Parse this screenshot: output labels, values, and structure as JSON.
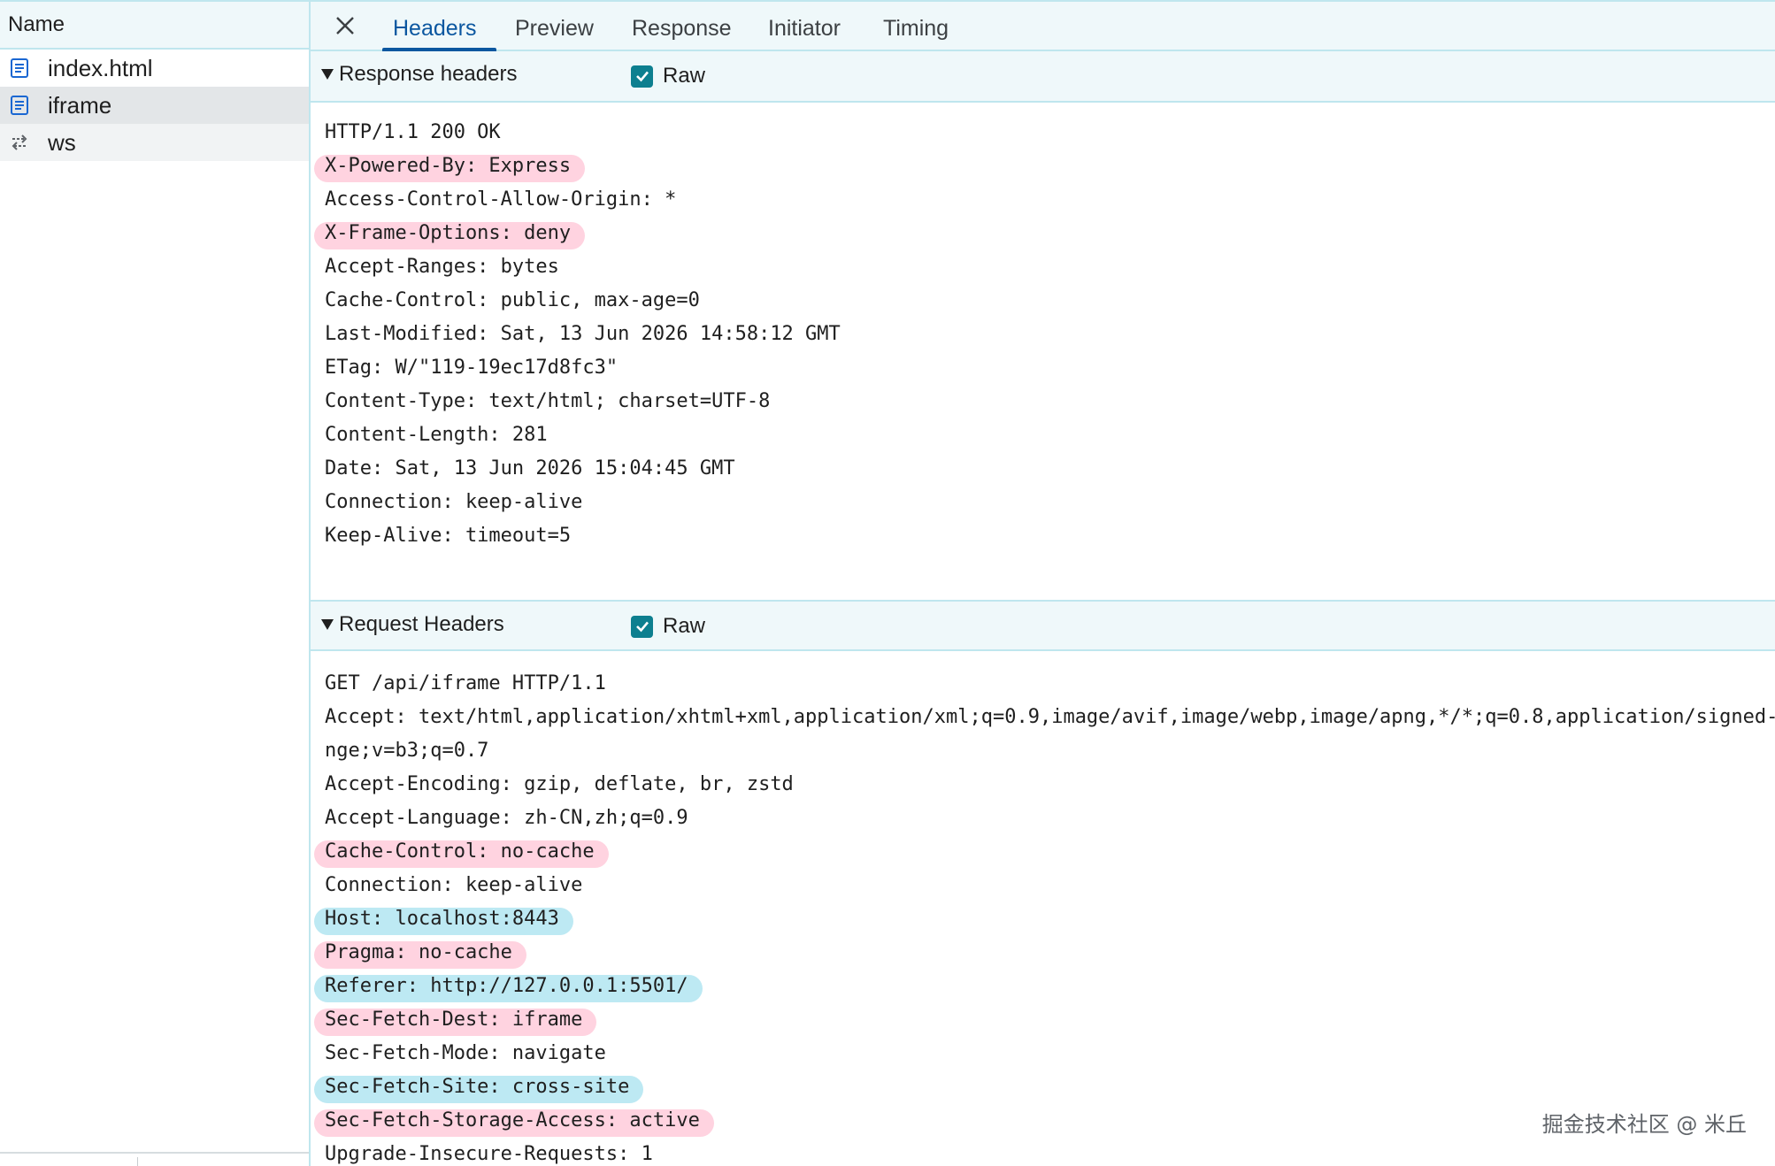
{
  "sidebar": {
    "header": "Name",
    "items": [
      {
        "label": "index.html",
        "icon": "document-icon"
      },
      {
        "label": "iframe",
        "icon": "document-icon"
      },
      {
        "label": "ws",
        "icon": "websocket-icon"
      }
    ]
  },
  "tabs": [
    "Headers",
    "Preview",
    "Response",
    "Initiator",
    "Timing"
  ],
  "active_tab": "Headers",
  "response_section": {
    "title": "Response headers",
    "raw_label": "Raw",
    "raw_checked": true,
    "lines": [
      {
        "text": "HTTP/1.1 200 OK",
        "highlight": ""
      },
      {
        "text": "X-Powered-By: Express",
        "highlight": "pink"
      },
      {
        "text": "Access-Control-Allow-Origin: *",
        "highlight": ""
      },
      {
        "text": "X-Frame-Options: deny",
        "highlight": "pink"
      },
      {
        "text": "Accept-Ranges: bytes",
        "highlight": ""
      },
      {
        "text": "Cache-Control: public, max-age=0",
        "highlight": ""
      },
      {
        "text": "Last-Modified: Sat, 13 Jun 2026 14:58:12 GMT",
        "highlight": ""
      },
      {
        "text": "ETag: W/\"119-19ec17d8fc3\"",
        "highlight": ""
      },
      {
        "text": "Content-Type: text/html; charset=UTF-8",
        "highlight": ""
      },
      {
        "text": "Content-Length: 281",
        "highlight": ""
      },
      {
        "text": "Date: Sat, 13 Jun 2026 15:04:45 GMT",
        "highlight": ""
      },
      {
        "text": "Connection: keep-alive",
        "highlight": ""
      },
      {
        "text": "Keep-Alive: timeout=5",
        "highlight": ""
      }
    ]
  },
  "request_section": {
    "title": "Request Headers",
    "raw_label": "Raw",
    "raw_checked": true,
    "lines": [
      {
        "text": "GET /api/iframe HTTP/1.1",
        "highlight": ""
      },
      {
        "text": "Accept: text/html,application/xhtml+xml,application/xml;q=0.9,image/avif,image/webp,image/apng,*/*;q=0.8,application/signed-",
        "highlight": ""
      },
      {
        "text": "nge;v=b3;q=0.7",
        "highlight": ""
      },
      {
        "text": "Accept-Encoding: gzip, deflate, br, zstd",
        "highlight": ""
      },
      {
        "text": "Accept-Language: zh-CN,zh;q=0.9",
        "highlight": ""
      },
      {
        "text": "Cache-Control: no-cache",
        "highlight": "pink"
      },
      {
        "text": "Connection: keep-alive",
        "highlight": ""
      },
      {
        "text": "Host: localhost:8443",
        "highlight": "blue"
      },
      {
        "text": "Pragma: no-cache",
        "highlight": "pink"
      },
      {
        "text": "Referer: http://127.0.0.1:5501/",
        "highlight": "blue"
      },
      {
        "text": "Sec-Fetch-Dest: iframe",
        "highlight": "pink"
      },
      {
        "text": "Sec-Fetch-Mode: navigate",
        "highlight": ""
      },
      {
        "text": "Sec-Fetch-Site: cross-site",
        "highlight": "blue"
      },
      {
        "text": "Sec-Fetch-Storage-Access: active",
        "highlight": "pink"
      },
      {
        "text": "Upgrade-Insecure-Requests: 1",
        "highlight": ""
      }
    ]
  },
  "watermark": "掘金技术社区 @ 米丘",
  "colors": {
    "accent": "#0b57a0",
    "checkbox": "#0d7f8f",
    "highlight_pink": "#ffd3e0",
    "highlight_blue": "#bde9f3",
    "panel_border": "#bfe6ee"
  }
}
